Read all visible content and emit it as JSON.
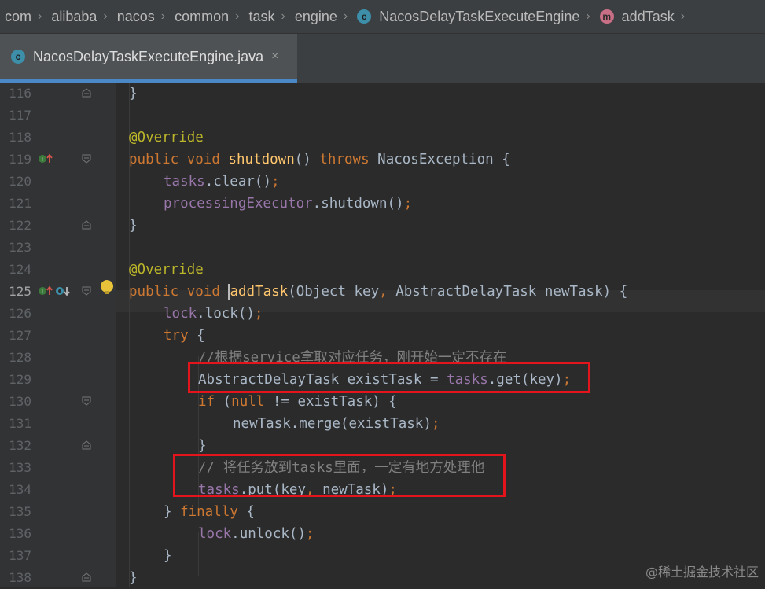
{
  "breadcrumb": [
    "com",
    "alibaba",
    "nacos",
    "common",
    "task",
    "engine",
    "NacosDelayTaskExecuteEngine",
    "addTask"
  ],
  "tab": {
    "label": "NacosDelayTaskExecuteEngine.java",
    "close": "×"
  },
  "icons": {
    "class": "class-c-icon",
    "method": "method-m-icon",
    "class_letter": "c",
    "method_letter": "m"
  },
  "line_numbers": [
    "116",
    "117",
    "118",
    "119",
    "120",
    "121",
    "122",
    "123",
    "124",
    "125",
    "126",
    "127",
    "128",
    "129",
    "130",
    "131",
    "132",
    "133",
    "134",
    "135",
    "136",
    "137",
    "138"
  ],
  "current_line": "125",
  "code": {
    "l116": "}",
    "l118": "@Override",
    "l119": {
      "kw1": "public",
      "kw2": "void",
      "name": "shutdown",
      "p": "()",
      "kw3": "throws",
      "rest": "NacosException {"
    },
    "l120": {
      "field": "tasks",
      "rest": ".clear()",
      "semi": ";"
    },
    "l121": {
      "field": "processingExecutor",
      "rest": ".shutdown()",
      "semi": ";"
    },
    "l122": "}",
    "l124": "@Override",
    "l125": {
      "kw1": "public",
      "kw2": "void",
      "name": "addTask",
      "args": "(Object key",
      "comma": ",",
      "args2": " AbstractDelayTask newTask) {"
    },
    "l126": {
      "field": "lock",
      "rest": ".lock()",
      "semi": ";"
    },
    "l127": {
      "kw": "try",
      "rest": " {"
    },
    "l128": "//根据service拿取对应任务，刚开始一定不存在",
    "l129": {
      "pre": "AbstractDelayTask existTask = ",
      "field": "tasks",
      "rest": ".get(key)",
      "semi": ";"
    },
    "l130": {
      "kw": "if",
      "p1": " (",
      "kw2": "null",
      "rest": " != existTask) {"
    },
    "l131": {
      "rest": "newTask.merge(existTask)",
      "semi": ";"
    },
    "l132": "}",
    "l133": "// 将任务放到tasks里面，一定有地方处理他",
    "l134": {
      "field": "tasks",
      "rest": ".put(key",
      "comma": ",",
      "rest2": " newTask)",
      "semi": ";"
    },
    "l135": {
      "pre": "} ",
      "kw": "finally",
      "rest": " {"
    },
    "l136": {
      "field": "lock",
      "rest": ".unlock()",
      "semi": ";"
    },
    "l137": "}",
    "l138": "}"
  },
  "watermark": "@稀土掘金技术社区",
  "colors": {
    "keyword": "#cc7832",
    "annotation": "#bbb529",
    "method": "#ffc66d",
    "field": "#9876aa",
    "comment": "#808080",
    "highlight_box": "#e3141b",
    "tab_underline": "#4a88c7"
  }
}
